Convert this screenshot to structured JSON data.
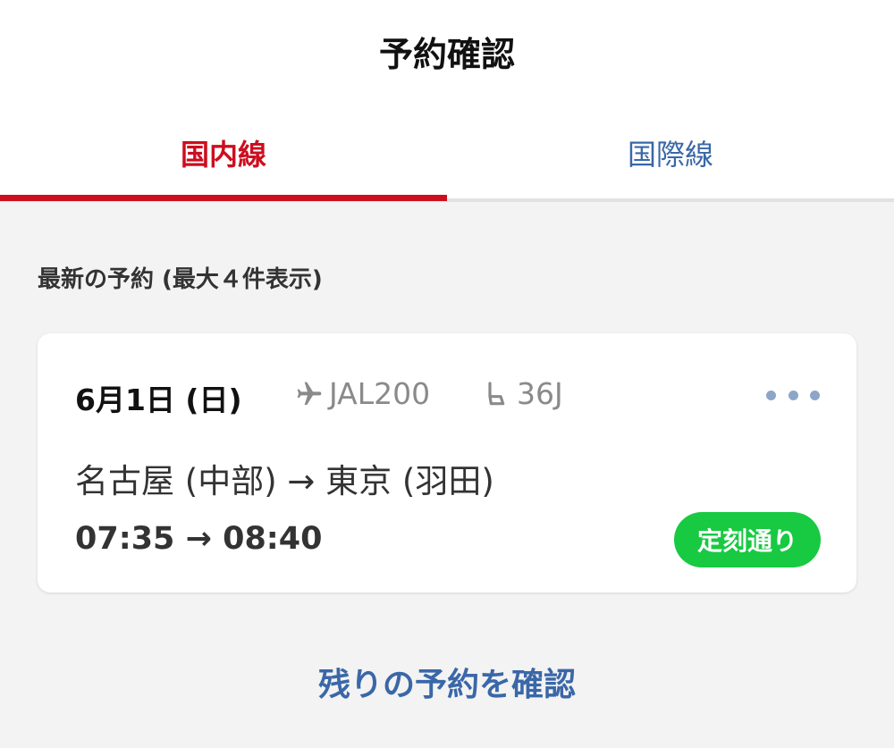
{
  "header": {
    "title": "予約確認"
  },
  "tabs": [
    {
      "label": "国内線",
      "active": true
    },
    {
      "label": "国際線",
      "active": false
    }
  ],
  "section": {
    "label": "最新の予約 (最大４件表示)"
  },
  "booking": {
    "date": "6月1日 (日)",
    "flight_icon": "airplane-icon",
    "flight_number": "JAL200",
    "seat_icon": "seat-icon",
    "seat": "36J",
    "more_icon": "more-horizontal-icon",
    "route": "名古屋 (中部) → 東京 (羽田)",
    "times": "07:35 → 08:40",
    "status": "定刻通り",
    "status_color": "#18c942"
  },
  "footer": {
    "more_link": "残りの予約を確認"
  },
  "colors": {
    "accent_red": "#cc0e1f",
    "link_blue": "#3a67a8"
  }
}
